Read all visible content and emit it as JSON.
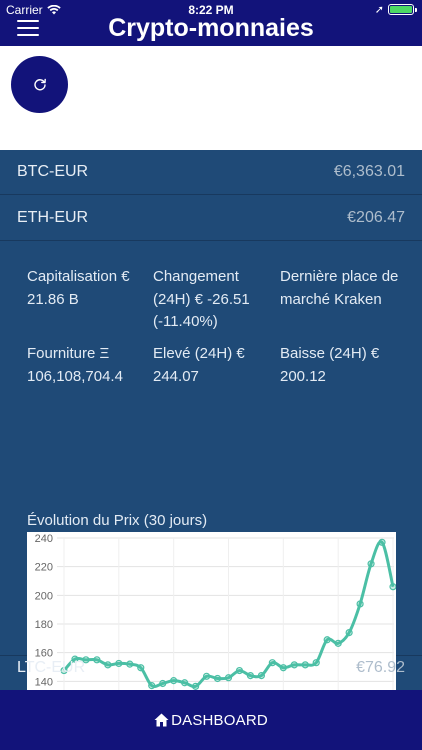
{
  "status": {
    "carrier": "Carrier",
    "time": "8:22 PM"
  },
  "header": {
    "title": "Crypto-monnaies"
  },
  "rows": [
    {
      "pair": "BTC-EUR",
      "price": "€6,363.01"
    },
    {
      "pair": "ETH-EUR",
      "price": "€206.47"
    },
    {
      "pair": "LTC-EUR",
      "price": "€76.92"
    }
  ],
  "details": {
    "market_cap": "Capitalisation € 21.86 B",
    "change": "Changement (24H) € -26.51 (-11.40%)",
    "last_market": "Dernière place de marché Kraken",
    "supply": "Fourniture Ξ 106,108,704.4",
    "high": "Elevé (24H) € 244.07",
    "low": "Baisse (24H) € 200.12"
  },
  "chart_title": "Évolution du Prix (30 jours)",
  "chart_data": {
    "type": "line",
    "x": [
      1,
      2,
      3,
      4,
      5,
      6,
      7,
      8,
      9,
      10,
      11,
      12,
      13,
      14,
      15,
      16,
      17,
      18,
      19,
      20,
      21,
      22,
      23,
      24,
      25,
      26,
      27,
      28,
      29,
      30,
      31
    ],
    "values": [
      147.5,
      155.5,
      155,
      155,
      151.5,
      152.5,
      152,
      149.5,
      137,
      138.5,
      140.5,
      139,
      136.5,
      143.5,
      142,
      142.5,
      147.5,
      144,
      144,
      153,
      149.5,
      151.5,
      151.5,
      153,
      169,
      166.5,
      174,
      194,
      222,
      237,
      206
    ],
    "yticks": [
      120,
      140,
      160,
      180,
      200,
      220,
      240
    ],
    "ylim": [
      120,
      240
    ],
    "grid": true,
    "color": "#4bbfa5"
  },
  "footer": {
    "label": "DASHBOARD"
  }
}
